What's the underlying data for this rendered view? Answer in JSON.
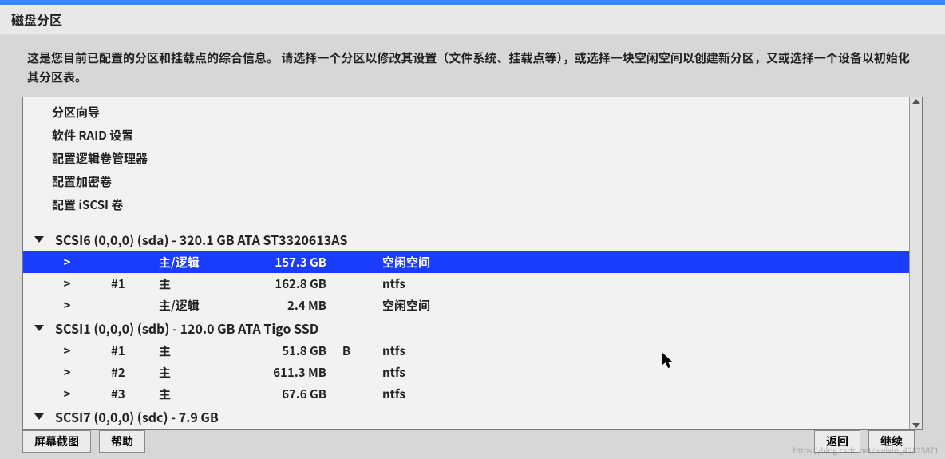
{
  "window": {
    "title": "磁盘分区"
  },
  "intro": "这是您目前已配置的分区和挂载点的综合信息。 请选择一个分区以修改其设置（文件系统、挂载点等），或选择一块空闲空间以创建新分区，又或选择一个设备以初始化其分区表。",
  "options": {
    "guided": "分区向导",
    "raid": "软件 RAID 设置",
    "lvm": "配置逻辑卷管理器",
    "crypt": "配置加密卷",
    "iscsi": "配置 iSCSI 卷"
  },
  "disks": [
    {
      "header": "SCSI6 (0,0,0) (sda) - 320.1 GB ATA ST3320613AS",
      "partitions": [
        {
          "caret": ">",
          "num": "",
          "type": "主/逻辑",
          "size": "157.3 GB",
          "flag": "",
          "fs": "空闲空间",
          "selected": true
        },
        {
          "caret": ">",
          "num": "#1",
          "type": "主",
          "size": "162.8 GB",
          "flag": "",
          "fs": "ntfs",
          "selected": false
        },
        {
          "caret": ">",
          "num": "",
          "type": "主/逻辑",
          "size": "2.4 MB",
          "flag": "",
          "fs": "空闲空间",
          "selected": false
        }
      ]
    },
    {
      "header": "SCSI1 (0,0,0) (sdb) - 120.0 GB ATA Tigo SSD",
      "partitions": [
        {
          "caret": ">",
          "num": "#1",
          "type": "主",
          "size": "51.8 GB",
          "flag": "B",
          "fs": "ntfs",
          "selected": false
        },
        {
          "caret": ">",
          "num": "#2",
          "type": "主",
          "size": "611.3 MB",
          "flag": "",
          "fs": "ntfs",
          "selected": false
        },
        {
          "caret": ">",
          "num": "#3",
          "type": "主",
          "size": "67.6 GB",
          "flag": "",
          "fs": "ntfs",
          "selected": false
        }
      ]
    },
    {
      "header": "SCSI7 (0,0,0) (sdc) - 7.9 GB",
      "partitions": []
    }
  ],
  "buttons": {
    "screenshot": "屏幕截图",
    "help": "帮助",
    "back": "返回",
    "continue": "继续"
  },
  "watermark": "https://blog.csdn.net/weixin_42825871"
}
